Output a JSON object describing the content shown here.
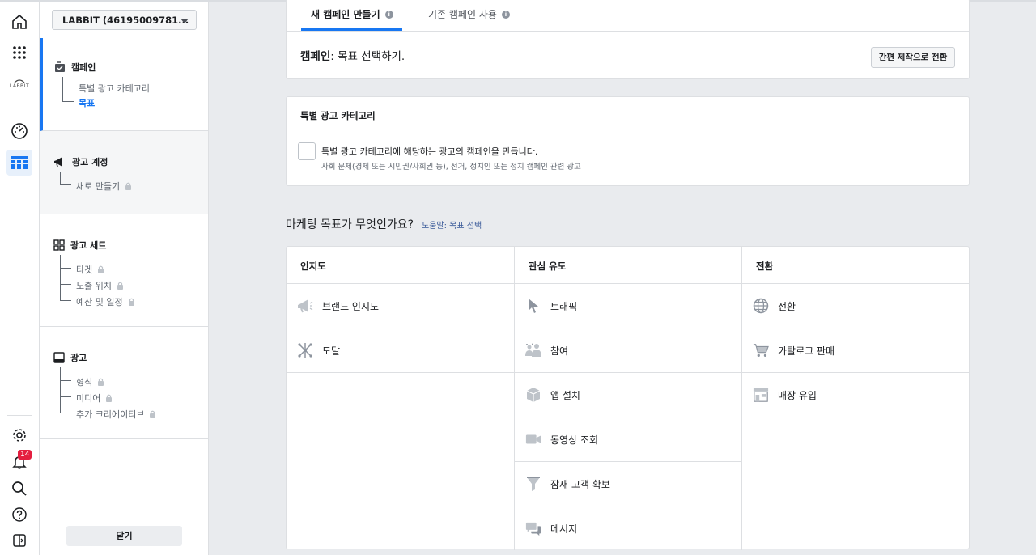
{
  "rail": {
    "logo_text": "LABBIT",
    "notification_count": "14"
  },
  "nav": {
    "account_name": "LABBIT (46195009781...",
    "campaign": {
      "title": "캠페인",
      "items": [
        "특별 광고 카테고리",
        "목표"
      ]
    },
    "ad_account": {
      "title": "광고 계정",
      "items": [
        "새로 만들기"
      ]
    },
    "ad_set": {
      "title": "광고 세트",
      "items": [
        "타겟",
        "노출 위치",
        "예산 및 일정"
      ]
    },
    "ad": {
      "title": "광고",
      "items": [
        "형식",
        "미디어",
        "추가 크리에이티브"
      ]
    },
    "close_label": "닫기"
  },
  "tabs": {
    "new_campaign": "새 캠페인 만들기",
    "existing_campaign": "기존 캠페인 사용"
  },
  "campaign_card": {
    "label_bold": "캠페인",
    "label_rest": ": 목표 선택하기.",
    "switch_button": "간편 제작으로 전환"
  },
  "special_category": {
    "title": "특별 광고 카테고리",
    "checkbox_label": "특별 광고 카테고리에 해당하는 광고의 캠페인을 만듭니다.",
    "description": "사회 문제(경제 또는 시민권/사회권 등), 선거, 정치인 또는 정치 캠페인 관련 광고"
  },
  "marketing": {
    "question": "마케팅 목표가 무엇인가요?",
    "help_link": "도움말: 목표 선택"
  },
  "objectives": {
    "awareness": {
      "header": "인지도",
      "items": [
        {
          "label": "브랜드 인지도",
          "icon": "megaphone-icon"
        },
        {
          "label": "도달",
          "icon": "reach-icon"
        }
      ]
    },
    "consideration": {
      "header": "관심 유도",
      "items": [
        {
          "label": "트래픽",
          "icon": "cursor-icon"
        },
        {
          "label": "참여",
          "icon": "people-icon"
        },
        {
          "label": "앱 설치",
          "icon": "box-icon"
        },
        {
          "label": "동영상 조회",
          "icon": "video-icon"
        },
        {
          "label": "잠재 고객 확보",
          "icon": "funnel-icon"
        },
        {
          "label": "메시지",
          "icon": "chat-icon"
        }
      ]
    },
    "conversion": {
      "header": "전환",
      "items": [
        {
          "label": "전환",
          "icon": "globe-icon"
        },
        {
          "label": "카탈로그 판매",
          "icon": "cart-icon"
        },
        {
          "label": "매장 유입",
          "icon": "store-icon"
        }
      ]
    }
  }
}
